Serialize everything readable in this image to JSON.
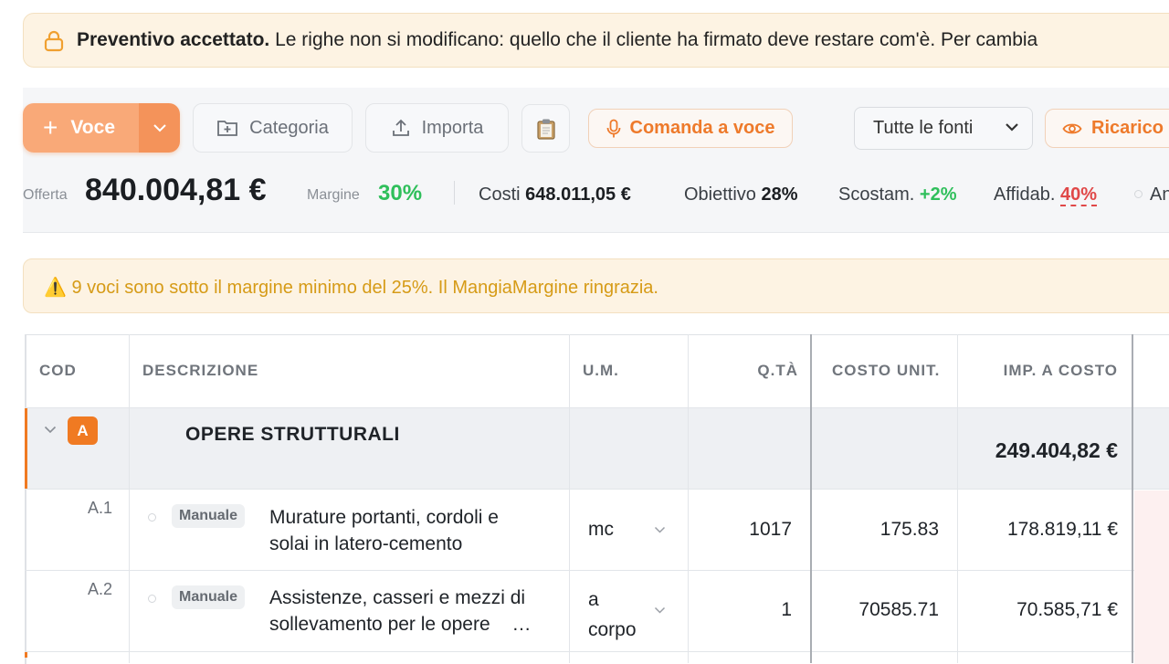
{
  "lock_banner": {
    "title": "Preventivo accettato.",
    "message": "Le righe non si modificano: quello che il cliente ha firmato deve restare com'è. Per cambia"
  },
  "toolbar": {
    "voce_label": "Voce",
    "categoria_label": "Categoria",
    "importa_label": "Importa",
    "voice_command_label": "Comanda a voce",
    "source_select": {
      "selected": "Tutte le fonti"
    },
    "ricarico_label": "Ricarico"
  },
  "stats": {
    "offerta_label": "Offerta",
    "offerta_value": "840.004,81 €",
    "margine_label": "Margine",
    "margine_value": "30%",
    "costi_label": "Costi",
    "costi_value": "648.011,05 €",
    "obiettivo_label": "Obiettivo",
    "obiettivo_value": "28%",
    "scostam_label": "Scostam.",
    "scostam_value": "+2%",
    "affidab_label": "Affidab.",
    "affidab_value": "40%",
    "cut_label": "An"
  },
  "warning": {
    "icon": "⚠️",
    "message": "9 voci sono sotto il margine minimo del 25%. Il MangiaMargine ringrazia."
  },
  "table": {
    "headers": [
      "COD",
      "DESCRIZIONE",
      "U.M.",
      "Q.TÀ",
      "COSTO UNIT.",
      "IMP. A COSTO"
    ],
    "group": {
      "badge": "A",
      "title": "OPERE STRUTTURALI",
      "total": "249.404,82 €"
    },
    "rows": [
      {
        "code": "A.1",
        "tag": "Manuale",
        "desc_line1": "Murature portanti, cordoli e",
        "desc_line2": "solai in latero-cemento",
        "um": "mc",
        "um_line2": "",
        "qty": "1017",
        "unit_cost": "175.83",
        "total": "178.819,11 €"
      },
      {
        "code": "A.2",
        "tag": "Manuale",
        "desc_line1": "Assistenze, casseri e mezzi di",
        "desc_line2": "sollevamento per le opere",
        "ellipsis": "…",
        "um": "a",
        "um_line2": "corpo",
        "qty": "1",
        "unit_cost": "70585.71",
        "total": "70.585,71 €"
      }
    ]
  },
  "colors": {
    "accent": "#f07a22",
    "green": "#2fbf5b",
    "red": "#e04848",
    "warning_text": "#d69b17"
  }
}
